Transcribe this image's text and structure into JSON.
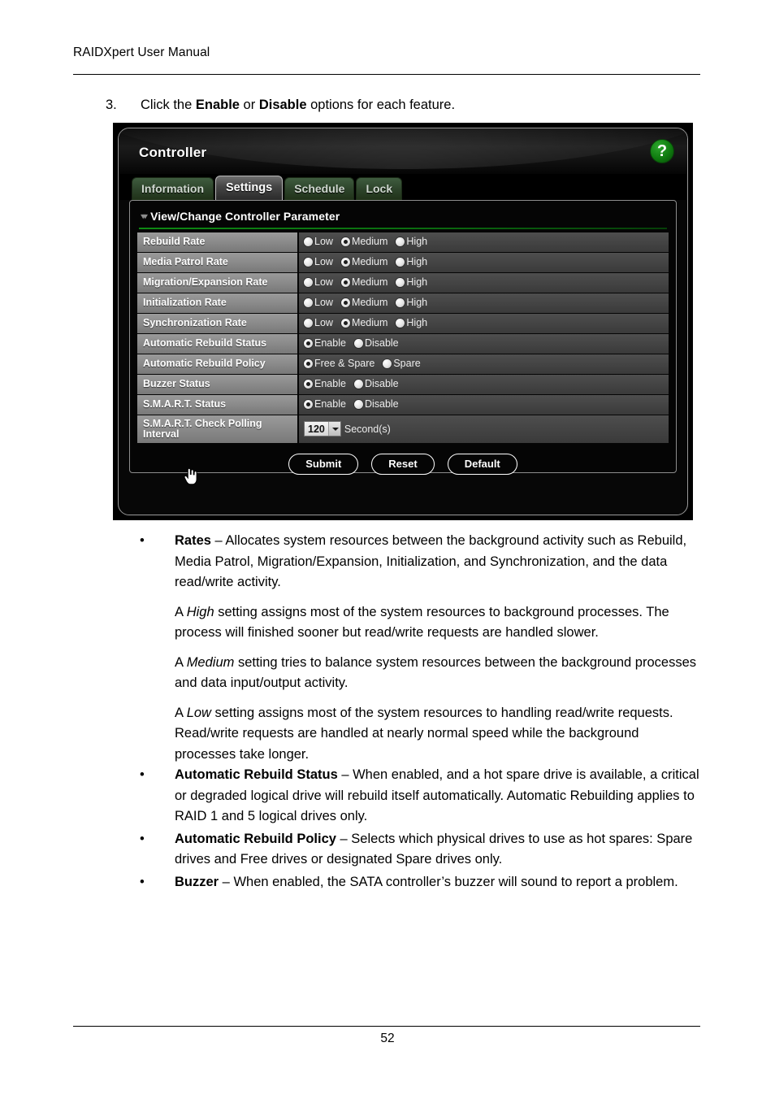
{
  "document": {
    "running_head": "RAIDXpert User Manual",
    "page_number": "52",
    "step": {
      "number": "3.",
      "text_parts": [
        "Click the ",
        "Enable",
        " or ",
        "Disable",
        " options for each feature."
      ]
    }
  },
  "app": {
    "title": "Controller",
    "help_icon": "?",
    "tabs": [
      {
        "label": "Information",
        "active": false
      },
      {
        "label": "Settings",
        "active": true
      },
      {
        "label": "Schedule",
        "active": false
      },
      {
        "label": "Lock",
        "active": false
      }
    ],
    "panel": {
      "heading": "View/Change Controller Parameter",
      "collapse_chevrons": "⌄⌄",
      "rows": [
        {
          "label": "Rebuild Rate",
          "type": "radio",
          "options": [
            {
              "label": "Low",
              "selected": false
            },
            {
              "label": "Medium",
              "selected": true
            },
            {
              "label": "High",
              "selected": false
            }
          ]
        },
        {
          "label": "Media Patrol Rate",
          "type": "radio",
          "options": [
            {
              "label": "Low",
              "selected": false
            },
            {
              "label": "Medium",
              "selected": true
            },
            {
              "label": "High",
              "selected": false
            }
          ]
        },
        {
          "label": "Migration/Expansion Rate",
          "type": "radio",
          "options": [
            {
              "label": "Low",
              "selected": false
            },
            {
              "label": "Medium",
              "selected": true
            },
            {
              "label": "High",
              "selected": false
            }
          ]
        },
        {
          "label": "Initialization Rate",
          "type": "radio",
          "options": [
            {
              "label": "Low",
              "selected": false
            },
            {
              "label": "Medium",
              "selected": true
            },
            {
              "label": "High",
              "selected": false
            }
          ]
        },
        {
          "label": "Synchronization Rate",
          "type": "radio",
          "options": [
            {
              "label": "Low",
              "selected": false
            },
            {
              "label": "Medium",
              "selected": true
            },
            {
              "label": "High",
              "selected": false
            }
          ]
        },
        {
          "label": "Automatic Rebuild Status",
          "type": "radio",
          "options": [
            {
              "label": "Enable",
              "selected": true
            },
            {
              "label": "Disable",
              "selected": false
            }
          ]
        },
        {
          "label": "Automatic Rebuild Policy",
          "type": "radio",
          "options": [
            {
              "label": "Free & Spare",
              "selected": true
            },
            {
              "label": "Spare",
              "selected": false
            }
          ]
        },
        {
          "label": "Buzzer Status",
          "type": "radio",
          "options": [
            {
              "label": "Enable",
              "selected": true
            },
            {
              "label": "Disable",
              "selected": false
            }
          ]
        },
        {
          "label": "S.M.A.R.T. Status",
          "type": "radio",
          "options": [
            {
              "label": "Enable",
              "selected": true
            },
            {
              "label": "Disable",
              "selected": false
            }
          ]
        },
        {
          "label": "S.M.A.R.T. Check Polling Interval",
          "type": "select",
          "value": "120",
          "unit": "Second(s)"
        }
      ],
      "buttons": [
        {
          "label": "Submit"
        },
        {
          "label": "Reset"
        },
        {
          "label": "Default"
        }
      ]
    }
  },
  "body": {
    "items": [
      {
        "kind": "bullet",
        "bold": "Rates",
        "text": " – Allocates system resources between the background activity such as Rebuild, Media Patrol, Migration/Expansion, Initialization, and Synchronization, and the data read/write activity."
      },
      {
        "kind": "para_italic",
        "pre": "A ",
        "italic": "High",
        "text": " setting assigns most of the system resources to background processes. The process will finished sooner but read/write requests are handled slower."
      },
      {
        "kind": "para_italic",
        "pre": "A ",
        "italic": "Medium",
        "text": " setting tries to balance system resources between the background processes and data input/output activity."
      },
      {
        "kind": "para_italic",
        "pre": "A ",
        "italic": "Low",
        "text": " setting assigns most of the system resources to handling read/write requests. Read/write requests are handled at nearly normal speed while the background processes take longer."
      },
      {
        "kind": "bullet",
        "bold": "Automatic Rebuild Status",
        "text": " – When enabled, and a hot spare drive is available, a critical or degraded logical drive will rebuild itself automatically. Automatic Rebuilding applies to RAID 1 and 5 logical drives only."
      },
      {
        "kind": "bullet",
        "bold": "Automatic Rebuild Policy",
        "text": " – Selects which physical drives to use as hot spares: Spare drives and Free drives or designated Spare drives only."
      },
      {
        "kind": "bullet",
        "bold": "Buzzer",
        "text": " – When enabled, the SATA controller’s buzzer will sound to report a problem."
      }
    ],
    "bullet_glyph": "•"
  },
  "colors": {
    "tab_green": "#2c4229",
    "panel_rule_green": "#0d8a13",
    "help_green": "#0f7b0f",
    "label_gray": "#8a8a8a",
    "value_gray": "#434343"
  }
}
